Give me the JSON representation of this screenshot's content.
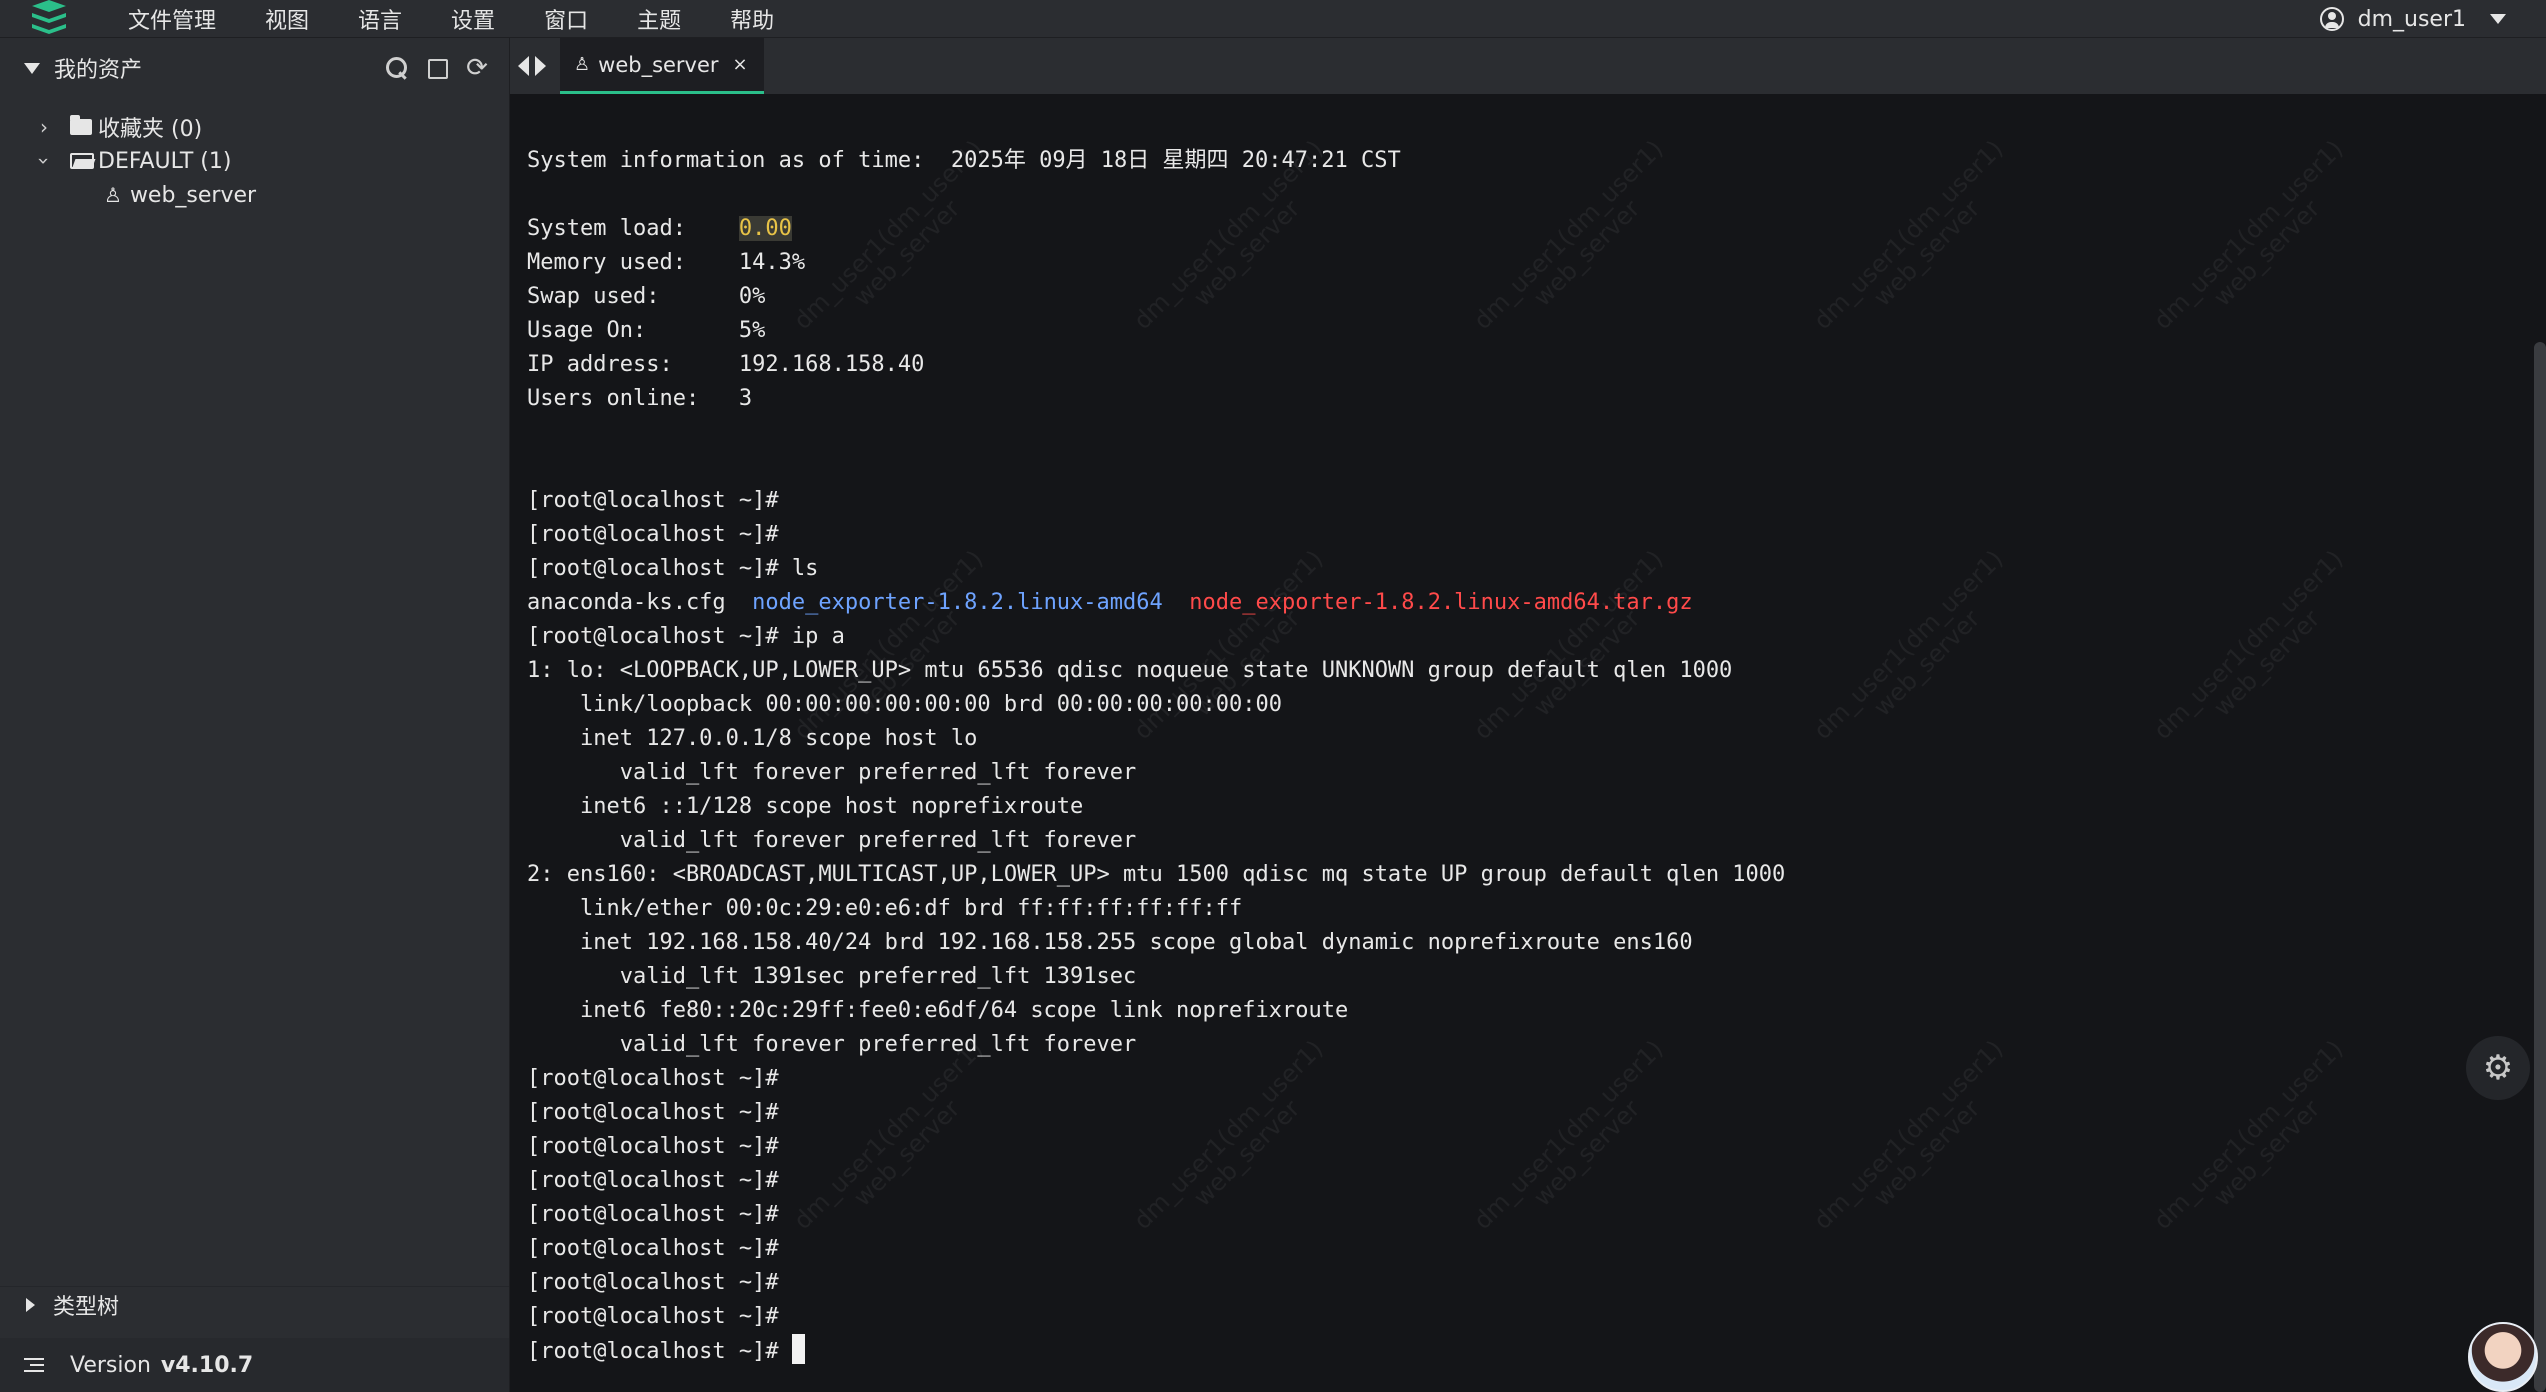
{
  "menu": {
    "items": [
      "文件管理",
      "视图",
      "语言",
      "设置",
      "窗口",
      "主题",
      "帮助"
    ],
    "user": "dm_user1"
  },
  "sidebar": {
    "title": "我的资产",
    "tree": {
      "favorites": "收藏夹 (0)",
      "default_group": "DEFAULT (1)",
      "host": "web_server"
    },
    "category_tree": "类型树",
    "version_label": "Version",
    "version_number": "v4.10.7"
  },
  "tabs": [
    {
      "label": "web_server",
      "close": "×"
    }
  ],
  "terminal": {
    "lines": [
      "System information as of time:  2025年 09月 18日 星期四 20:47:21 CST",
      "",
      "System load:    0.00",
      "Memory used:    14.3%",
      "Swap used:      0%",
      "Usage On:       5%",
      "IP address:     192.168.158.40",
      "Users online:   3",
      "",
      "",
      "[root@localhost ~]#",
      "[root@localhost ~]#",
      "[root@localhost ~]# ls",
      "anaconda-ks.cfg  node_exporter-1.8.2.linux-amd64  node_exporter-1.8.2.linux-amd64.tar.gz",
      "[root@localhost ~]# ip a",
      "1: lo: <LOOPBACK,UP,LOWER_UP> mtu 65536 qdisc noqueue state UNKNOWN group default qlen 1000",
      "    link/loopback 00:00:00:00:00:00 brd 00:00:00:00:00:00",
      "    inet 127.0.0.1/8 scope host lo",
      "       valid_lft forever preferred_lft forever",
      "    inet6 ::1/128 scope host noprefixroute",
      "       valid_lft forever preferred_lft forever",
      "2: ens160: <BROADCAST,MULTICAST,UP,LOWER_UP> mtu 1500 qdisc mq state UP group default qlen 1000",
      "    link/ether 00:0c:29:e0:e6:df brd ff:ff:ff:ff:ff:ff",
      "    inet 192.168.158.40/24 brd 192.168.158.255 scope global dynamic noprefixroute ens160",
      "       valid_lft 1391sec preferred_lft 1391sec",
      "    inet6 fe80::20c:29ff:fee0:e6df/64 scope link noprefixroute",
      "       valid_lft forever preferred_lft forever",
      "[root@localhost ~]#",
      "[root@localhost ~]#",
      "[root@localhost ~]#",
      "[root@localhost ~]#",
      "[root@localhost ~]#",
      "[root@localhost ~]#",
      "[root@localhost ~]#",
      "[root@localhost ~]#",
      "[root@localhost ~]# "
    ],
    "watermark_line1": "dm_user1(dm_user1)",
    "watermark_line2": "web_server"
  },
  "colors": {
    "accent": "#2bbf8a",
    "dir_blue": "#6ea3ff",
    "archive_red": "#ff4a4a",
    "load_yellow": "#e8c347"
  },
  "icons": [
    "app-logo-icon",
    "user-icon",
    "search-icon",
    "square-icon",
    "refresh-icon",
    "folder-icon",
    "folder-open-icon",
    "linux-icon",
    "gear-icon",
    "list-icon"
  ]
}
